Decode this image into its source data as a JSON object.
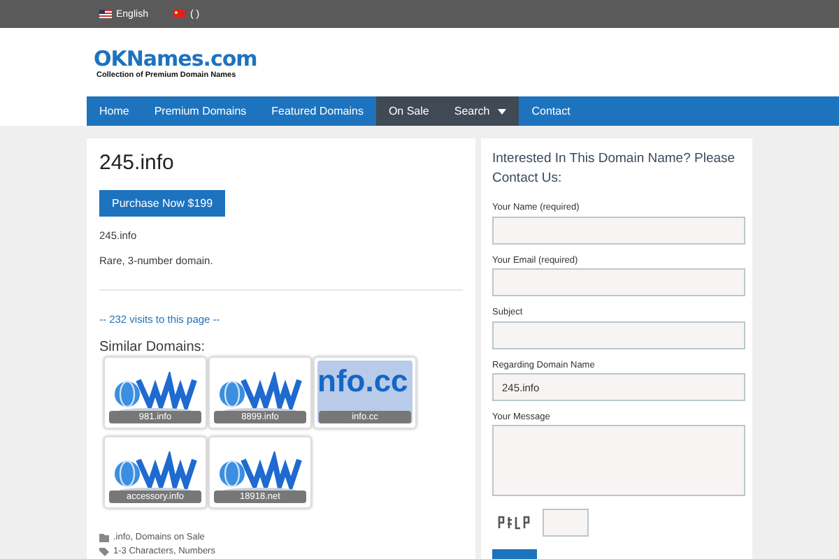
{
  "top_bar": {
    "languages": [
      {
        "label": "English",
        "kind": "us"
      },
      {
        "label": "(   )",
        "kind": "cn"
      }
    ]
  },
  "header": {
    "logo": "OKNames.com",
    "tagline": "Collection of Premium Domain Names"
  },
  "nav": [
    {
      "label": "Home",
      "selected": false,
      "dropdown": false
    },
    {
      "label": "Premium Domains",
      "selected": false,
      "dropdown": false
    },
    {
      "label": "Featured Domains",
      "selected": false,
      "dropdown": false
    },
    {
      "label": "On Sale",
      "selected": true,
      "dropdown": false
    },
    {
      "label": "Search",
      "selected": true,
      "dropdown": true
    },
    {
      "label": "Contact",
      "selected": false,
      "dropdown": false
    }
  ],
  "main": {
    "title": "245.info",
    "purchase_button": "Purchase Now $199",
    "domain": "245.info",
    "description": "Rare, 3-number domain.",
    "visits": "-- 232 visits to this page --",
    "similar_heading": "Similar Domains:",
    "similar": [
      {
        "name": "981.info",
        "kind": "www"
      },
      {
        "name": "8899.info",
        "kind": "www"
      },
      {
        "name": "info.cc",
        "kind": "text"
      },
      {
        "name": "accessory.info",
        "kind": "www"
      },
      {
        "name": "18918.net",
        "kind": "www"
      }
    ],
    "thumb_text": "nfo.cc",
    "categories": ".info, Domains on Sale",
    "tags": "1-3 Characters, Numbers"
  },
  "contact": {
    "heading": "Interested In This Domain Name? Please Contact Us:",
    "fields": [
      {
        "label": "Your Name (required)",
        "kind": "input"
      },
      {
        "label": "Your Email (required)",
        "kind": "input"
      },
      {
        "label": "Subject",
        "kind": "input"
      },
      {
        "label": "Regarding Domain Name",
        "kind": "input",
        "value": "245.info"
      },
      {
        "label": "Your Message",
        "kind": "textarea"
      }
    ]
  }
}
